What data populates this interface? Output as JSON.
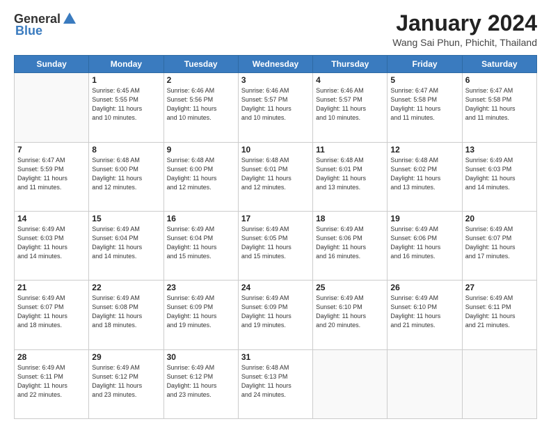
{
  "header": {
    "logo_general": "General",
    "logo_blue": "Blue",
    "title": "January 2024",
    "location": "Wang Sai Phun, Phichit, Thailand"
  },
  "calendar": {
    "days": [
      "Sunday",
      "Monday",
      "Tuesday",
      "Wednesday",
      "Thursday",
      "Friday",
      "Saturday"
    ],
    "weeks": [
      [
        {
          "day": "",
          "info": ""
        },
        {
          "day": "1",
          "info": "Sunrise: 6:45 AM\nSunset: 5:55 PM\nDaylight: 11 hours\nand 10 minutes."
        },
        {
          "day": "2",
          "info": "Sunrise: 6:46 AM\nSunset: 5:56 PM\nDaylight: 11 hours\nand 10 minutes."
        },
        {
          "day": "3",
          "info": "Sunrise: 6:46 AM\nSunset: 5:57 PM\nDaylight: 11 hours\nand 10 minutes."
        },
        {
          "day": "4",
          "info": "Sunrise: 6:46 AM\nSunset: 5:57 PM\nDaylight: 11 hours\nand 10 minutes."
        },
        {
          "day": "5",
          "info": "Sunrise: 6:47 AM\nSunset: 5:58 PM\nDaylight: 11 hours\nand 11 minutes."
        },
        {
          "day": "6",
          "info": "Sunrise: 6:47 AM\nSunset: 5:58 PM\nDaylight: 11 hours\nand 11 minutes."
        }
      ],
      [
        {
          "day": "7",
          "info": "Sunrise: 6:47 AM\nSunset: 5:59 PM\nDaylight: 11 hours\nand 11 minutes."
        },
        {
          "day": "8",
          "info": "Sunrise: 6:48 AM\nSunset: 6:00 PM\nDaylight: 11 hours\nand 12 minutes."
        },
        {
          "day": "9",
          "info": "Sunrise: 6:48 AM\nSunset: 6:00 PM\nDaylight: 11 hours\nand 12 minutes."
        },
        {
          "day": "10",
          "info": "Sunrise: 6:48 AM\nSunset: 6:01 PM\nDaylight: 11 hours\nand 12 minutes."
        },
        {
          "day": "11",
          "info": "Sunrise: 6:48 AM\nSunset: 6:01 PM\nDaylight: 11 hours\nand 13 minutes."
        },
        {
          "day": "12",
          "info": "Sunrise: 6:48 AM\nSunset: 6:02 PM\nDaylight: 11 hours\nand 13 minutes."
        },
        {
          "day": "13",
          "info": "Sunrise: 6:49 AM\nSunset: 6:03 PM\nDaylight: 11 hours\nand 14 minutes."
        }
      ],
      [
        {
          "day": "14",
          "info": "Sunrise: 6:49 AM\nSunset: 6:03 PM\nDaylight: 11 hours\nand 14 minutes."
        },
        {
          "day": "15",
          "info": "Sunrise: 6:49 AM\nSunset: 6:04 PM\nDaylight: 11 hours\nand 14 minutes."
        },
        {
          "day": "16",
          "info": "Sunrise: 6:49 AM\nSunset: 6:04 PM\nDaylight: 11 hours\nand 15 minutes."
        },
        {
          "day": "17",
          "info": "Sunrise: 6:49 AM\nSunset: 6:05 PM\nDaylight: 11 hours\nand 15 minutes."
        },
        {
          "day": "18",
          "info": "Sunrise: 6:49 AM\nSunset: 6:06 PM\nDaylight: 11 hours\nand 16 minutes."
        },
        {
          "day": "19",
          "info": "Sunrise: 6:49 AM\nSunset: 6:06 PM\nDaylight: 11 hours\nand 16 minutes."
        },
        {
          "day": "20",
          "info": "Sunrise: 6:49 AM\nSunset: 6:07 PM\nDaylight: 11 hours\nand 17 minutes."
        }
      ],
      [
        {
          "day": "21",
          "info": "Sunrise: 6:49 AM\nSunset: 6:07 PM\nDaylight: 11 hours\nand 18 minutes."
        },
        {
          "day": "22",
          "info": "Sunrise: 6:49 AM\nSunset: 6:08 PM\nDaylight: 11 hours\nand 18 minutes."
        },
        {
          "day": "23",
          "info": "Sunrise: 6:49 AM\nSunset: 6:09 PM\nDaylight: 11 hours\nand 19 minutes."
        },
        {
          "day": "24",
          "info": "Sunrise: 6:49 AM\nSunset: 6:09 PM\nDaylight: 11 hours\nand 19 minutes."
        },
        {
          "day": "25",
          "info": "Sunrise: 6:49 AM\nSunset: 6:10 PM\nDaylight: 11 hours\nand 20 minutes."
        },
        {
          "day": "26",
          "info": "Sunrise: 6:49 AM\nSunset: 6:10 PM\nDaylight: 11 hours\nand 21 minutes."
        },
        {
          "day": "27",
          "info": "Sunrise: 6:49 AM\nSunset: 6:11 PM\nDaylight: 11 hours\nand 21 minutes."
        }
      ],
      [
        {
          "day": "28",
          "info": "Sunrise: 6:49 AM\nSunset: 6:11 PM\nDaylight: 11 hours\nand 22 minutes."
        },
        {
          "day": "29",
          "info": "Sunrise: 6:49 AM\nSunset: 6:12 PM\nDaylight: 11 hours\nand 23 minutes."
        },
        {
          "day": "30",
          "info": "Sunrise: 6:49 AM\nSunset: 6:12 PM\nDaylight: 11 hours\nand 23 minutes."
        },
        {
          "day": "31",
          "info": "Sunrise: 6:48 AM\nSunset: 6:13 PM\nDaylight: 11 hours\nand 24 minutes."
        },
        {
          "day": "",
          "info": ""
        },
        {
          "day": "",
          "info": ""
        },
        {
          "day": "",
          "info": ""
        }
      ]
    ]
  }
}
